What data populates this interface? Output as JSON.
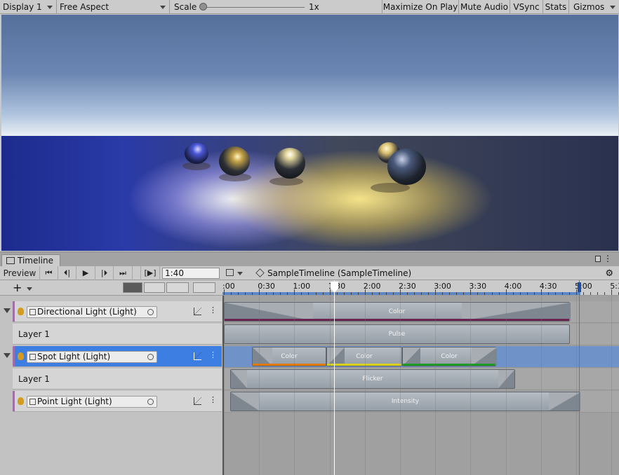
{
  "game_view": {
    "display": "Display 1",
    "aspect": "Free Aspect",
    "scale_label": "Scale",
    "scale_value": "1x",
    "scale_level": 0,
    "buttons": [
      "Maximize On Play",
      "Mute Audio",
      "VSync",
      "Stats",
      "Gizmos"
    ]
  },
  "timeline": {
    "tab_label": "Timeline",
    "preview_label": "Preview",
    "time_value": "1:40",
    "breadcrumb": "SampleTimeline (SampleTimeline)",
    "ruler_ticks": [
      ":00",
      "0:30",
      "1:00",
      "1:30",
      "2:00",
      "2:30",
      "3:00",
      "3:30",
      "4:00",
      "4:30",
      "5:00",
      "5:3"
    ],
    "playhead_time": "1:40",
    "end_time": "5:00",
    "tracks": [
      {
        "name": "Directional Light (Light)",
        "layer": "Layer 1"
      },
      {
        "name": "Spot Light (Light)",
        "layer": "Layer 1",
        "selected": true
      },
      {
        "name": "Point Light (Light)"
      }
    ],
    "clips": {
      "directional_color": "Color",
      "directional_pulse": "Pulse",
      "spot_color_1": "Color",
      "spot_color_2": "Color",
      "spot_color_3": "Color",
      "spot_flicker": "Flicker",
      "point_intensity": "Intensity"
    },
    "colors": {
      "selection": "#3d7ee2",
      "playhead": "#ffffff",
      "end_marker": "#4a78c8",
      "spot_underline_1": "#e07a10",
      "spot_underline_2": "#d8d21a",
      "spot_underline_3": "#1e9a28",
      "directional_underline": "#6a2650"
    }
  }
}
